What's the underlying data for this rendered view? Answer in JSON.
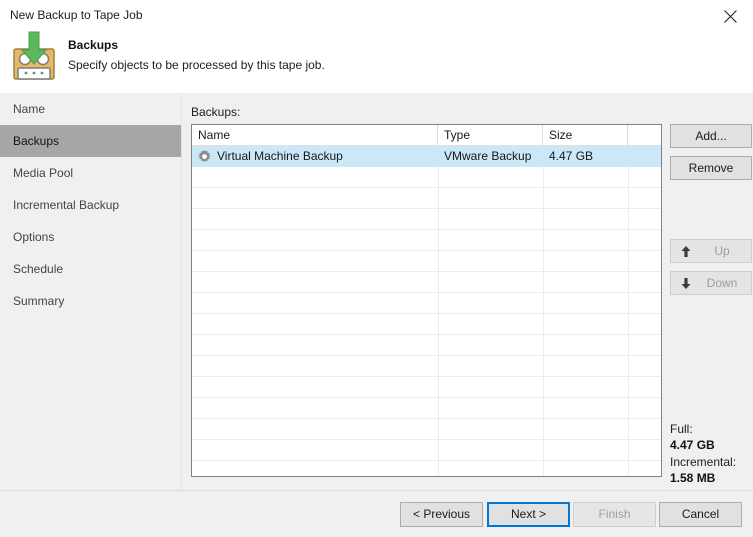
{
  "window": {
    "title": "New Backup to Tape Job",
    "close_icon": "close-icon"
  },
  "header": {
    "icon": "tape-backup-icon",
    "title": "Backups",
    "subtitle": "Specify objects to be processed by this tape job."
  },
  "sidebar": {
    "items": [
      {
        "label": "Name",
        "selected": false
      },
      {
        "label": "Backups",
        "selected": true
      },
      {
        "label": "Media Pool",
        "selected": false
      },
      {
        "label": "Incremental Backup",
        "selected": false
      },
      {
        "label": "Options",
        "selected": false
      },
      {
        "label": "Schedule",
        "selected": false
      },
      {
        "label": "Summary",
        "selected": false
      }
    ]
  },
  "main": {
    "list_label": "Backups:",
    "table": {
      "columns": [
        "Name",
        "Type",
        "Size"
      ],
      "rows": [
        {
          "icon": "gear-icon",
          "name": "Virtual Machine Backup",
          "type": "VMware Backup",
          "size": "4.47 GB",
          "selected": true
        }
      ]
    },
    "buttons": {
      "add": "Add...",
      "remove": "Remove",
      "up": "Up",
      "down": "Down",
      "up_icon": "arrow-up-icon",
      "down_icon": "arrow-down-icon"
    },
    "summary": {
      "full_label": "Full:",
      "full_value": "4.47 GB",
      "incremental_label": "Incremental:",
      "incremental_value": "1.58 MB"
    }
  },
  "footer": {
    "previous": "< Previous",
    "next": "Next >",
    "finish": "Finish",
    "cancel": "Cancel"
  },
  "colors": {
    "selection_blue": "#cbe8f9",
    "focus_blue": "#0078d7",
    "nav_selected_gray": "#a6a6a6",
    "panel_gray": "#f0f0f0",
    "tape_body": "#e8b964",
    "arrow_green": "#4caf50"
  }
}
